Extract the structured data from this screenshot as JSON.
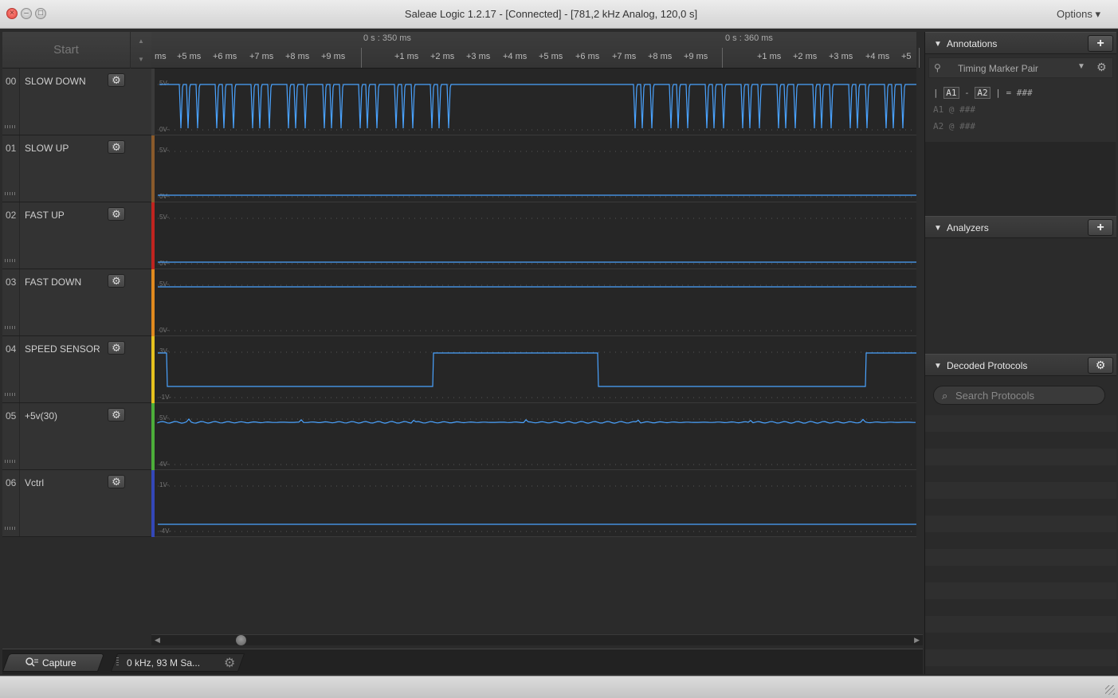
{
  "window": {
    "title": "Saleae Logic 1.2.17 - [Connected] - [781,2 kHz Analog, 120,0 s]",
    "options_label": "Options ▾"
  },
  "toolbar": {
    "start_label": "Start"
  },
  "channels": [
    {
      "num": "00",
      "name": "SLOW DOWN",
      "top_label": "5V-",
      "bot_label": "0V-",
      "color": "#3b3b3b"
    },
    {
      "num": "01",
      "name": "SLOW UP",
      "top_label": "5V-",
      "bot_label": "0V-",
      "color": "#8a5a2b"
    },
    {
      "num": "02",
      "name": "FAST UP",
      "top_label": "5V-",
      "bot_label": "0V-",
      "color": "#c0241f"
    },
    {
      "num": "03",
      "name": "FAST DOWN",
      "top_label": "5V-",
      "bot_label": "0V-",
      "color": "#e08a1e"
    },
    {
      "num": "04",
      "name": "SPEED SENSOR",
      "top_label": "3V-",
      "bot_label": "-1V-",
      "color": "#e6c21e"
    },
    {
      "num": "05",
      "name": "+5v(30)",
      "top_label": "5V-",
      "bot_label": "4V-",
      "color": "#4cae3a"
    },
    {
      "num": "06",
      "name": "Vctrl",
      "top_label": "1V-",
      "bot_label": "-4V-",
      "color": "#3347b8"
    }
  ],
  "ruler": {
    "major": [
      "0 s : 350 ms",
      "0 s : 360 ms"
    ],
    "minor_a": [
      "ms",
      "+5 ms",
      "+6 ms",
      "+7 ms",
      "+8 ms",
      "+9 ms"
    ],
    "minor_b": [
      "+1 ms",
      "+2 ms",
      "+3 ms",
      "+4 ms",
      "+5 ms",
      "+6 ms",
      "+7 ms",
      "+8 ms",
      "+9 ms"
    ],
    "minor_c": [
      "+1 ms",
      "+2 ms",
      "+3 ms",
      "+4 ms",
      "+5"
    ]
  },
  "bottom": {
    "capture_label": "Capture",
    "sample_label": "0 kHz, 93 M Sa..."
  },
  "annotations": {
    "title": "Annotations",
    "marker_pair": "Timing Marker Pair",
    "line1": {
      "a": "A1",
      "b": "A2",
      "value": "###"
    },
    "line2": {
      "name": "A1",
      "value": "###"
    },
    "line3": {
      "name": "A2",
      "value": "###"
    }
  },
  "analyzers": {
    "title": "Analyzers"
  },
  "decoded": {
    "title": "Decoded Protocols",
    "search_placeholder": "Search Protocols"
  },
  "colors": {
    "trace": "#4aa3ff",
    "accent_close": "#e0443e"
  }
}
